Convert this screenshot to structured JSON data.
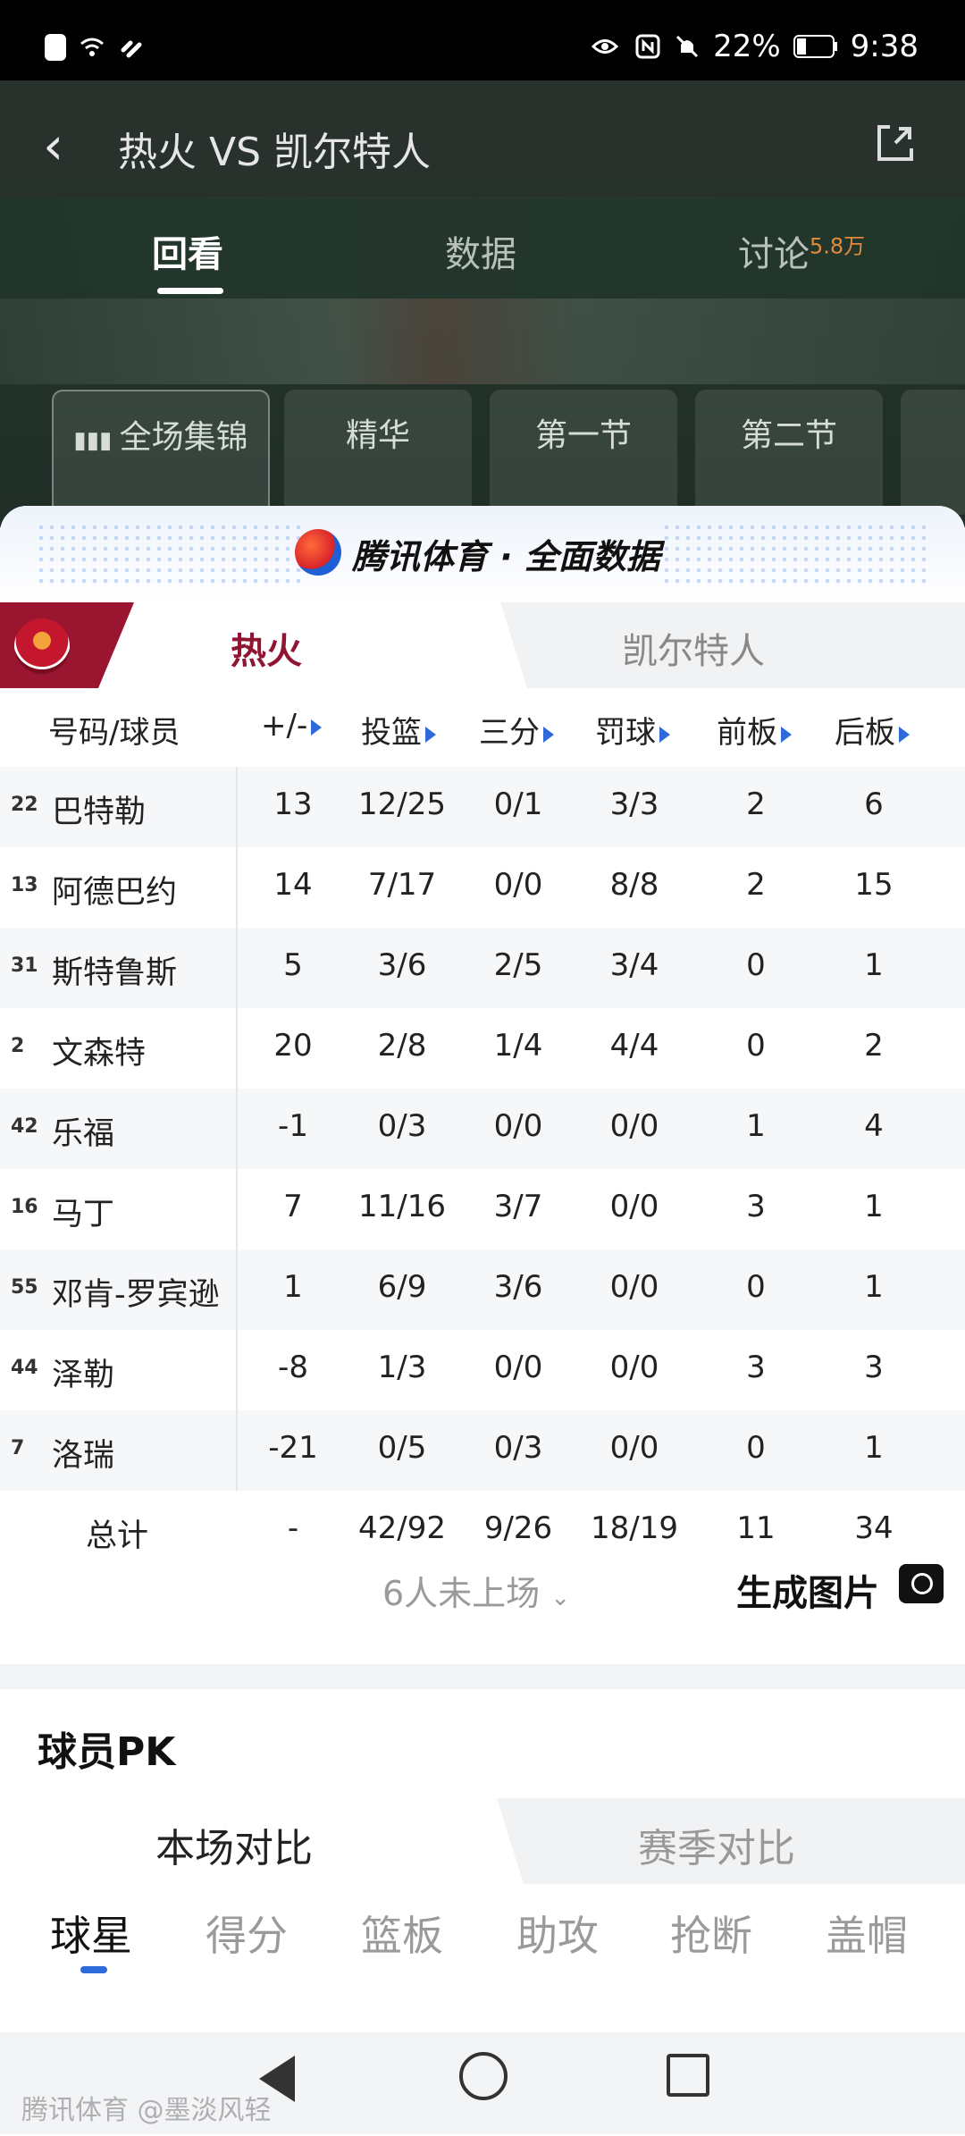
{
  "status": {
    "percent": "22%",
    "time": "9:38"
  },
  "header": {
    "title": "热火 VS 凯尔特人"
  },
  "tabs": [
    {
      "label": "回看"
    },
    {
      "label": "数据"
    },
    {
      "label": "讨论",
      "badge": "5.8万"
    }
  ],
  "chips": [
    "全场集锦",
    "精华",
    "第一节",
    "第二节"
  ],
  "brand": {
    "text": "腾讯体育 · 全面数据"
  },
  "teams": {
    "home": "热火",
    "away": "凯尔特人"
  },
  "columns": [
    "号码/球员",
    "+/-",
    "投篮",
    "三分",
    "罚球",
    "前板",
    "后板"
  ],
  "players": [
    {
      "num": "22",
      "name": "巴特勒",
      "pm": "13",
      "fg": "12/25",
      "tp": "0/1",
      "ft": "3/3",
      "oreb": "2",
      "dreb": "6"
    },
    {
      "num": "13",
      "name": "阿德巴约",
      "pm": "14",
      "fg": "7/17",
      "tp": "0/0",
      "ft": "8/8",
      "oreb": "2",
      "dreb": "15"
    },
    {
      "num": "31",
      "name": "斯特鲁斯",
      "pm": "5",
      "fg": "3/6",
      "tp": "2/5",
      "ft": "3/4",
      "oreb": "0",
      "dreb": "1"
    },
    {
      "num": "2",
      "name": "文森特",
      "pm": "20",
      "fg": "2/8",
      "tp": "1/4",
      "ft": "4/4",
      "oreb": "0",
      "dreb": "2"
    },
    {
      "num": "42",
      "name": "乐福",
      "pm": "-1",
      "fg": "0/3",
      "tp": "0/0",
      "ft": "0/0",
      "oreb": "1",
      "dreb": "4"
    },
    {
      "num": "16",
      "name": "马丁",
      "pm": "7",
      "fg": "11/16",
      "tp": "3/7",
      "ft": "0/0",
      "oreb": "3",
      "dreb": "1"
    },
    {
      "num": "55",
      "name": "邓肯-罗宾逊",
      "pm": "1",
      "fg": "6/9",
      "tp": "3/6",
      "ft": "0/0",
      "oreb": "0",
      "dreb": "1"
    },
    {
      "num": "44",
      "name": "泽勒",
      "pm": "-8",
      "fg": "1/3",
      "tp": "0/0",
      "ft": "0/0",
      "oreb": "3",
      "dreb": "3"
    },
    {
      "num": "7",
      "name": "洛瑞",
      "pm": "-21",
      "fg": "0/5",
      "tp": "0/3",
      "ft": "0/0",
      "oreb": "0",
      "dreb": "1"
    }
  ],
  "totals": {
    "label": "总计",
    "pm": "-",
    "fg": "42/92",
    "tp": "9/26",
    "ft": "18/19",
    "oreb": "11",
    "dreb": "34"
  },
  "footer": {
    "more": "6人未上场",
    "generate": "生成图片"
  },
  "pk": {
    "title": "球员PK",
    "tab_a": "本场对比",
    "tab_b": "赛季对比",
    "categories": [
      "球星",
      "得分",
      "篮板",
      "助攻",
      "抢断",
      "盖帽"
    ]
  },
  "watermark": "腾讯体育 @墨淡风轻"
}
